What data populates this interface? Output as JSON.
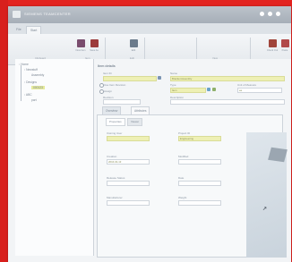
{
  "window": {
    "title": "SIEMENS TEAMCENTER",
    "controls": [
      "dot",
      "dot",
      "dot"
    ]
  },
  "tabs": [
    {
      "label": "File"
    },
    {
      "label": "Start"
    }
  ],
  "ribbon": {
    "buttons": [
      {
        "label": "New Item",
        "icon": "new-item-icon",
        "color": "#7a4d6e"
      },
      {
        "label": "Save As",
        "icon": "save-as-icon",
        "color": "#9c3b3b"
      },
      {
        "label": "Edit",
        "icon": "edit-icon",
        "color": "#6b7b8c"
      },
      {
        "label": "Check Out",
        "icon": "checkout-icon",
        "color": "#a0453b"
      },
      {
        "label": "Paste",
        "icon": "paste-icon",
        "color": "#b14a4a"
      }
    ],
    "groups": [
      "Clipboard",
      "Item",
      "Edit",
      "View"
    ]
  },
  "tree": {
    "items": [
      {
        "label": "Home"
      },
      {
        "label": "Newstuff"
      },
      {
        "label": "Assembly"
      },
      {
        "label": "Designs"
      },
      {
        "label": "000123"
      },
      {
        "label": "ABC"
      },
      {
        "label": "part"
      }
    ]
  },
  "main": {
    "section_title": "Item details",
    "fields": {
      "item_id_label": "Item ID",
      "item_id_value": "",
      "name_label": "Name",
      "name_value": "Bracket Assembly",
      "type_label": "Type",
      "type_value": "Item",
      "uom_label": "Unit of Measure",
      "uom_value": "ea",
      "rev_label": "Revision",
      "description_label": "Description",
      "description_value": "",
      "opt1_label": "Use Item Revision",
      "opt2_label": "Assign"
    },
    "subtabs": [
      {
        "label": "Overview"
      },
      {
        "label": "Attributes"
      }
    ],
    "detail": {
      "innertabs": [
        {
          "label": "Properties"
        },
        {
          "label": "Viewer"
        }
      ],
      "fields": [
        {
          "label": "Owning User",
          "value": ""
        },
        {
          "label": "Project ID",
          "value": "Engineering"
        },
        {
          "label": "Creation",
          "value": "2016-04-13"
        },
        {
          "label": "Modified",
          "value": ""
        },
        {
          "label": "Release Status",
          "value": ""
        },
        {
          "label": "Date",
          "value": ""
        },
        {
          "label": "Manufacturer",
          "value": ""
        },
        {
          "label": "Weight",
          "value": ""
        }
      ]
    }
  },
  "colors": {
    "accent_red": "#e3231f",
    "highlight": "#eef0b4",
    "titlebar": "#a6aeb8"
  }
}
